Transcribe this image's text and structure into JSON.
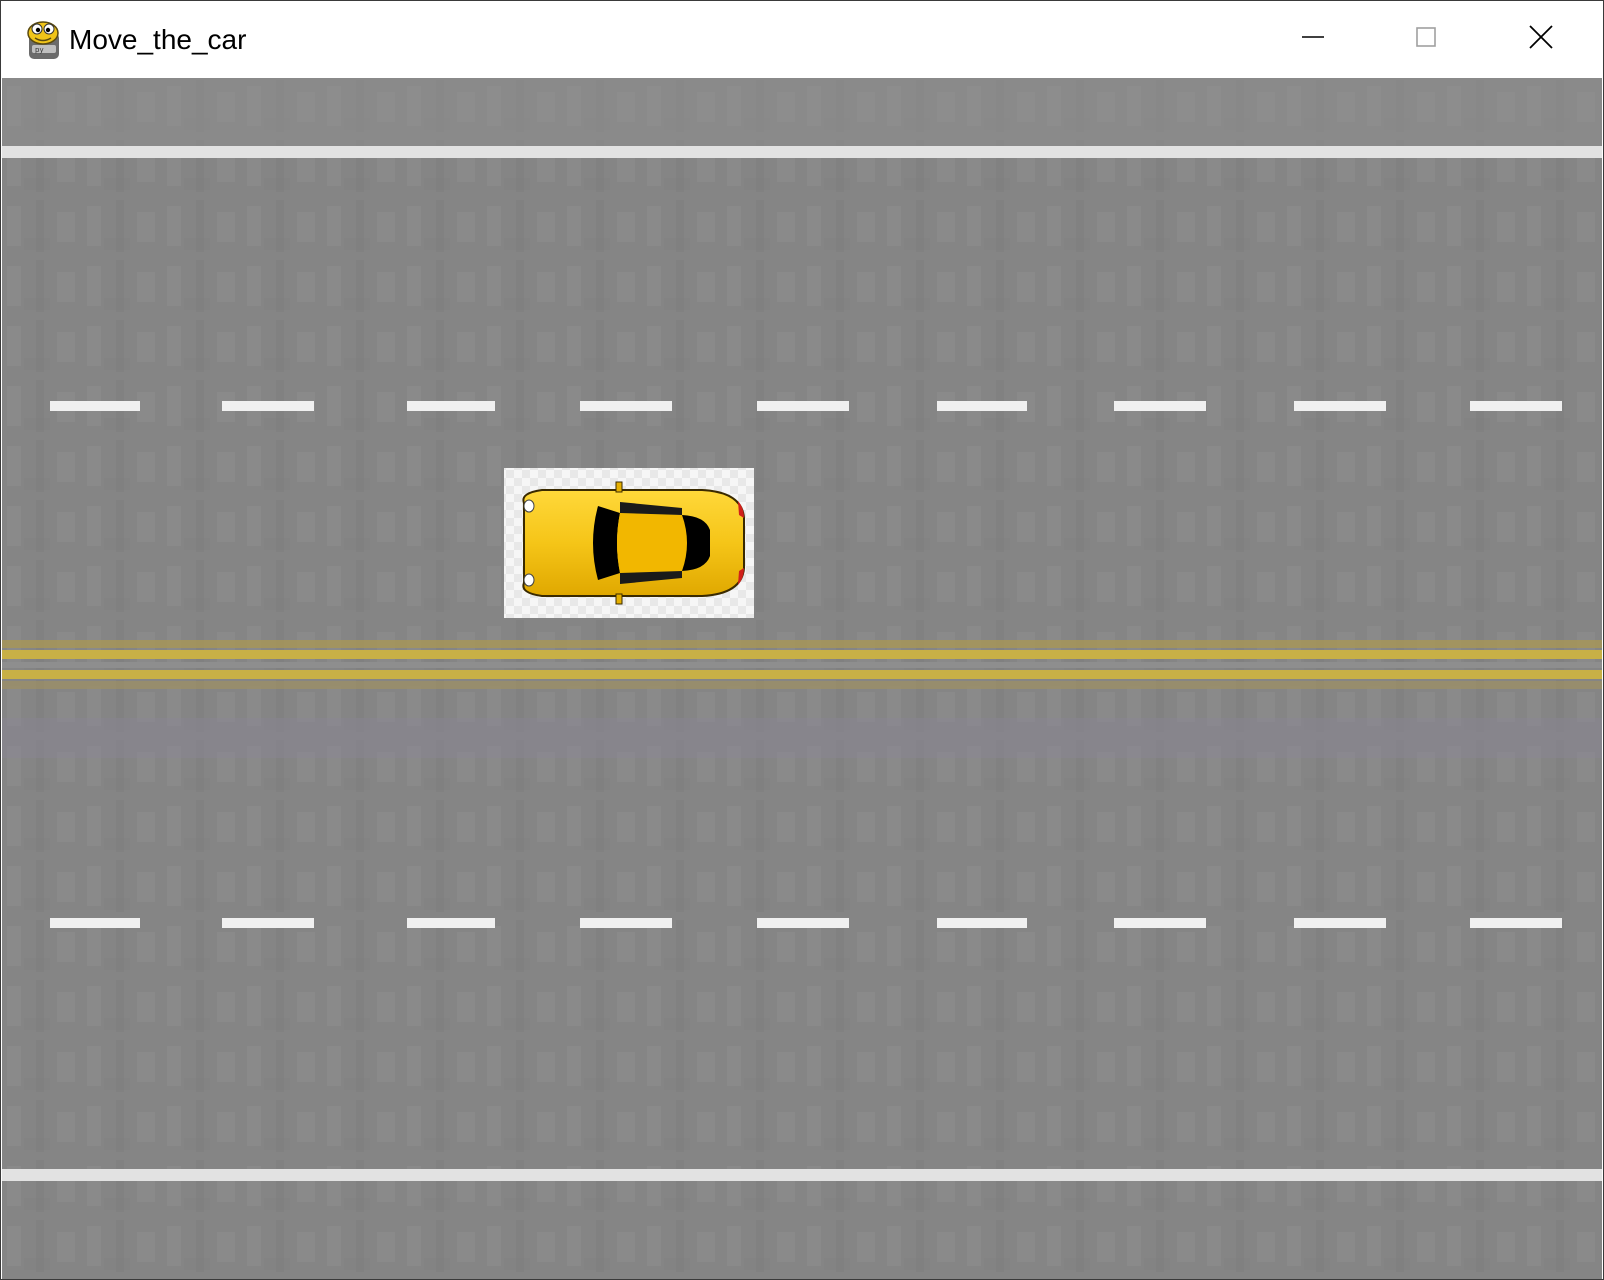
{
  "window": {
    "title": "Move_the_car",
    "app_icon": "pygame-snake-icon",
    "controls": [
      "minimize-icon",
      "maximize-icon",
      "close-icon"
    ]
  },
  "game": {
    "background": "asphalt-road",
    "lanes": {
      "count": 4
    },
    "colors": {
      "asphalt": "#858585",
      "white_line": "#eaeaea",
      "yellow_line": "#c8b046",
      "car_body": "#f5c518",
      "car_windows": "#000000",
      "sprite_background": "#f4f4f4"
    },
    "car": {
      "icon": "yellow-car-topdown",
      "facing": "right"
    }
  }
}
